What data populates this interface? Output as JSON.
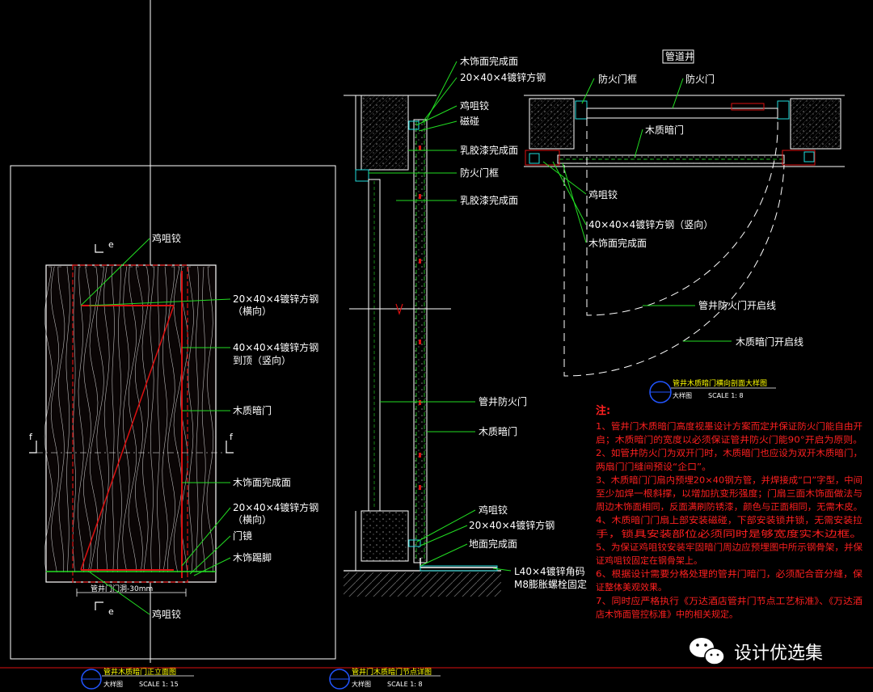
{
  "colors": {
    "background": "#000000",
    "leader": "#22dd22",
    "line_white": "#ffffff",
    "line_red": "#dd1010",
    "notes": "#ff2020",
    "title": "#ffff00"
  },
  "elevation": {
    "labels": {
      "hinge_top": "鸡咀铰",
      "tube_horizontal": "20×40×4镀锌方钢",
      "tube_horizontal_2": "（横向）",
      "tube_vertical": "40×40×4镀锌方钢",
      "tube_vertical_2": "到顶（竖向）",
      "hidden_door": "木质暗门",
      "wood_finish": "木饰面完成面",
      "tube_horizontal_b": "20×40×4镀锌方钢",
      "tube_horizontal_b2": "（横向）",
      "door_mirror": "门镜",
      "skirting": "木饰踢脚",
      "hinge_bottom": "鸡咀铰",
      "width_dim": "管井门门洞-30mm"
    },
    "section_marks": {
      "e_top": "e",
      "e_bottom": "e",
      "f_left": "f",
      "f_right": "f"
    },
    "title": {
      "name": "管井木质暗门正立面图",
      "sub": "大样图",
      "scale": "SCALE 1: 15"
    }
  },
  "vertical_section": {
    "labels": {
      "wood_finish": "木饰面完成面",
      "tube": "20×40×4镀锌方钢",
      "hinge": "鸡咀铰",
      "magnet": "磁碰",
      "latex_finish": "乳胶漆完成面",
      "fire_frame": "防火门框",
      "latex_finish_2": "乳胶漆完成面",
      "fire_door": "管井防火门",
      "hidden_door": "木质暗门",
      "hinge_2": "鸡咀铰",
      "tube_2": "20×40×4镀锌方钢",
      "floor_finish": "地面完成面",
      "angle_steel": "L40×4镀锌角码",
      "bolt": "M8膨胀螺栓固定"
    },
    "title": {
      "name": "管井门木质暗门节点详图",
      "sub": "大样图",
      "scale": "SCALE 1: 8"
    }
  },
  "horizontal_section": {
    "labels": {
      "shaft": "管道井",
      "fire_frame": "防火门框",
      "fire_door": "防火门",
      "hidden_door": "木质暗门",
      "hinge": "鸡咀铰",
      "tube": "40×40×4镀锌方钢（竖向）",
      "wood_finish": "木饰面完成面",
      "fire_swing": "管井防火门开启线",
      "wood_swing": "木质暗门开启线"
    },
    "title": {
      "name": "管井木质暗门横向剖面大样图",
      "sub": "大样图",
      "scale": "SCALE 1: 8"
    }
  },
  "notes": {
    "heading": "注:",
    "lines": [
      "1、管井门木质暗门高度视墨设计方案而定并保证防火门能自由开",
      "启；木质暗门的宽度以必须保证管井防火门能90°开启为原则。",
      "2、如管井防火门为双开门时，木质暗门也应设为双开木质暗门，",
      "两扇门门缝间预设“企口”。",
      "3、木质暗门门扇内预埋20×40钢方管，并焊接成“口”字型，中间",
      "至少加焊一根斜撑，以增加抗变形强度；门扇三面木饰面做法与",
      "周边木饰面相同，反面满刷防锈漆，颜色与正面相同，无需木皮。",
      "4、木质暗门门扇上部安装磁碰，下部安装锁井锁，无需安装拉",
      "手，锁具安装部位必须同时是够宽度实木边框。",
      "5、为保证鸡咀铰安装牢固暗门周边应预埋图中所示钢骨架，并保",
      "证鸡咀铰固定在钢骨架上。",
      "6、根据设计需要分格处理的管井门暗门，必须配合音分缝，保",
      "证整体美观效果。",
      "7、同时应严格执行《万达酒店管井门节点工艺标准》、《万达酒",
      "店木饰面管控标准》中的相关规定。"
    ]
  },
  "watermark": {
    "text": "设计优选集",
    "icon": "wechat-icon"
  }
}
